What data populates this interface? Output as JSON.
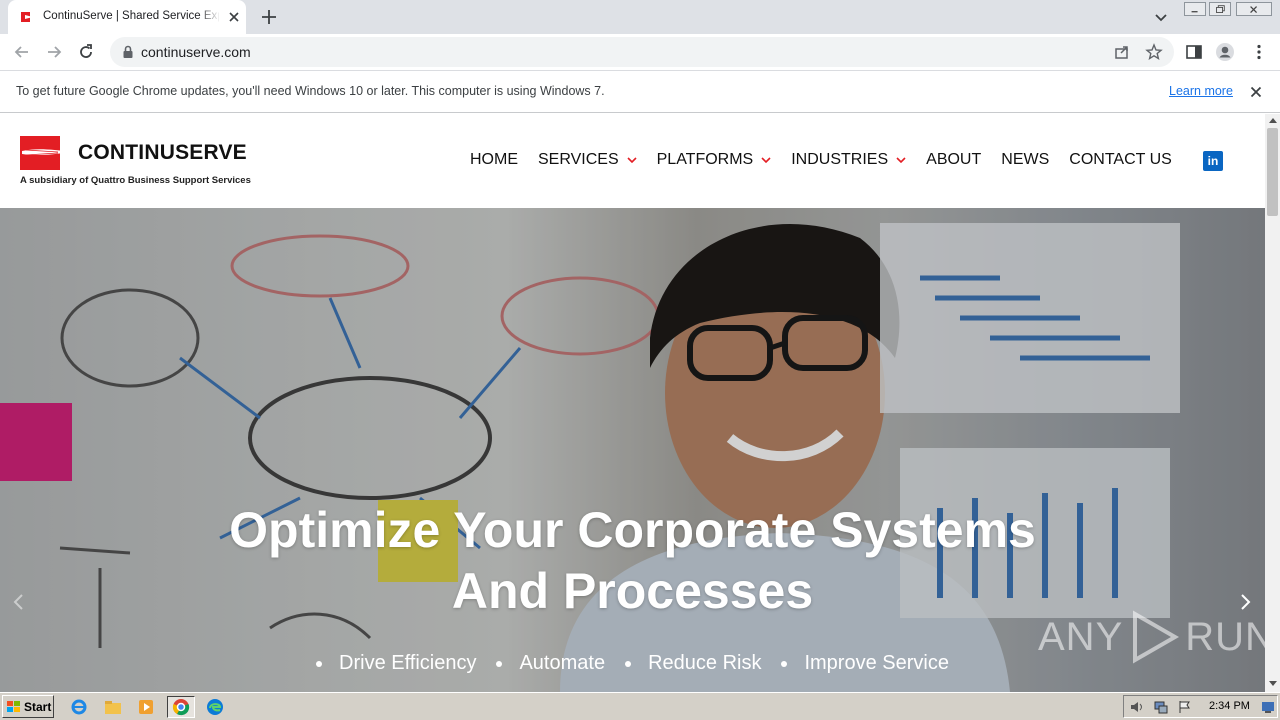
{
  "browser": {
    "tab_title": "ContinuServe | Shared Service Expe",
    "url": "continuserve.com",
    "infobar_message": "To get future Google Chrome updates, you'll need Windows 10 or later. This computer is using Windows 7.",
    "infobar_link": "Learn more"
  },
  "site": {
    "logo_name_part1": "CONTINU",
    "logo_name_part2": "SERVE",
    "logo_tagline": "A subsidiary of Quattro Business Support Services",
    "brand_color": "#e31e24",
    "nav": [
      {
        "label": "HOME",
        "dropdown": false
      },
      {
        "label": "SERVICES",
        "dropdown": true
      },
      {
        "label": "PLATFORMS",
        "dropdown": true
      },
      {
        "label": "INDUSTRIES",
        "dropdown": true
      },
      {
        "label": "ABOUT",
        "dropdown": false
      },
      {
        "label": "NEWS",
        "dropdown": false
      },
      {
        "label": "CONTACT US",
        "dropdown": false
      }
    ],
    "social_icon": "linkedin-icon",
    "social_label": "in"
  },
  "hero": {
    "title_line1": "Optimize Your Corporate Systems",
    "title_line2": "And Processes",
    "bullets": [
      "Drive Efficiency",
      "Automate",
      "Reduce Risk",
      "Improve Service"
    ],
    "watermark_left": "ANY",
    "watermark_right": "RUN"
  },
  "taskbar": {
    "start_label": "Start",
    "clock": "2:34 PM"
  }
}
